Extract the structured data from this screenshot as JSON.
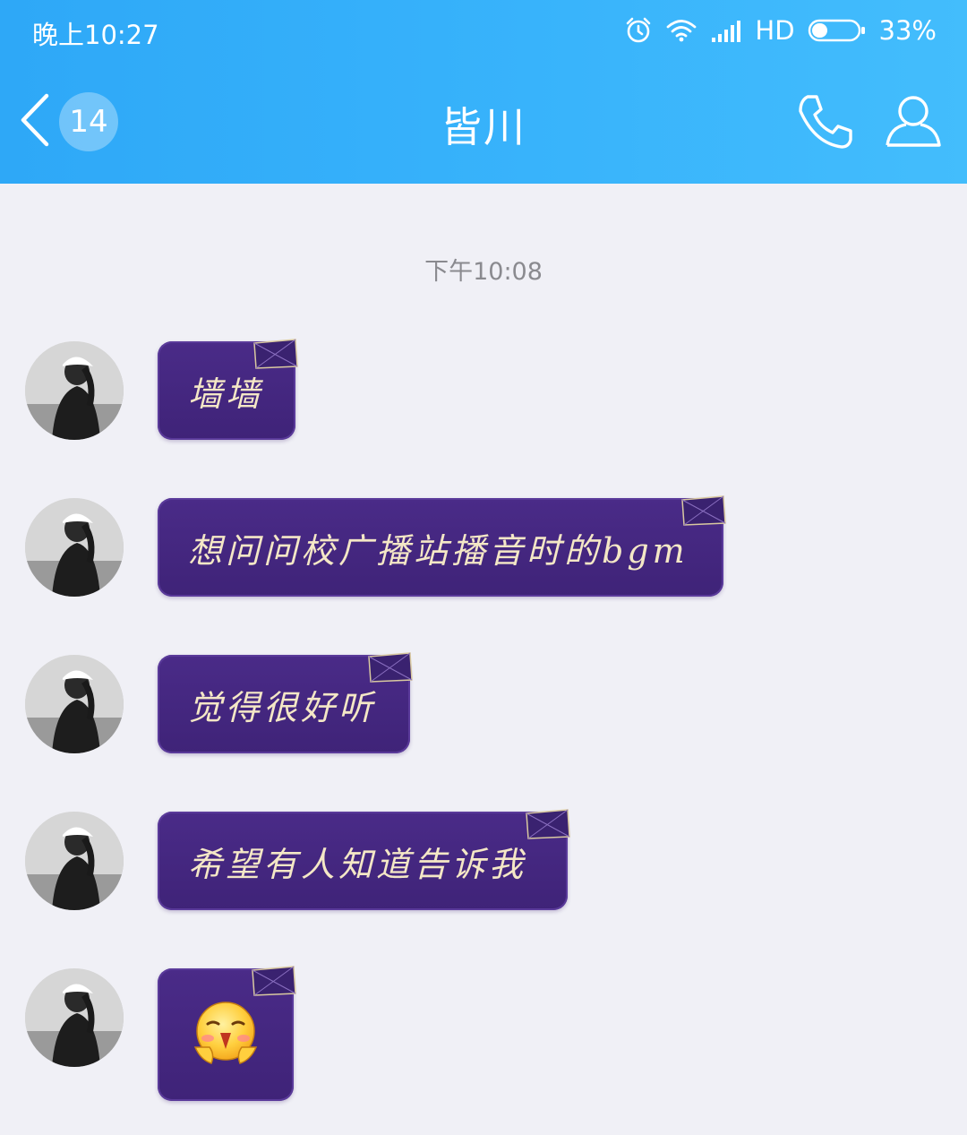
{
  "status_bar": {
    "time": "晚上10:27",
    "network_label": "HD",
    "battery_percent": "33%",
    "battery_level": 0.33,
    "icons": [
      "alarm-icon",
      "wifi-icon",
      "signal-icon",
      "battery-icon"
    ]
  },
  "header": {
    "back_icon": "chevron-left-icon",
    "unread_count": "14",
    "contact_name": "皆川",
    "call_icon": "phone-icon",
    "profile_icon": "person-icon"
  },
  "chat": {
    "timestamp": "下午10:08",
    "messages": [
      {
        "text": "墙墙"
      },
      {
        "text": "想问问校广播站播音时的bgm"
      },
      {
        "text": "觉得很好听"
      },
      {
        "text": "希望有人知道告诉我"
      },
      {
        "text": "",
        "emoji": "shy-smile-emoji"
      }
    ]
  },
  "colors": {
    "header_gradient_start": "#2ea8f7",
    "header_gradient_end": "#43bdfc",
    "bubble_background": "#45287f",
    "bubble_text": "#f4e7c6",
    "chat_background": "#f0f0f6",
    "timestamp_text": "#8a8a8f"
  }
}
